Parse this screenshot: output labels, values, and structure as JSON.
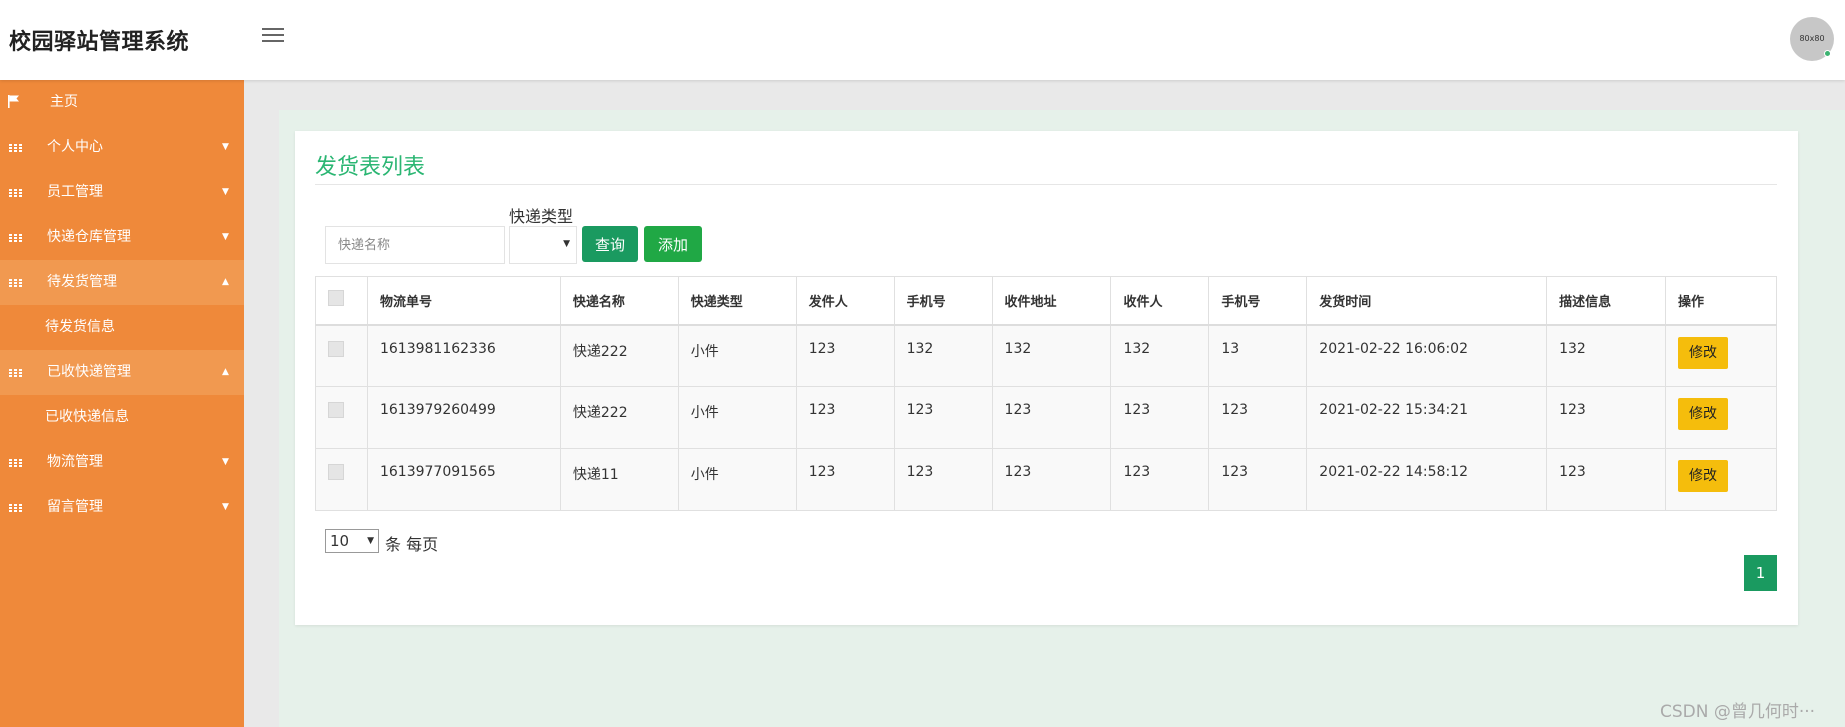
{
  "header": {
    "title": "校园驿站管理系统",
    "avatar_text": "80x80"
  },
  "sidebar": {
    "items": [
      {
        "label": "主页",
        "icon": "flag-icon"
      },
      {
        "label": "个人中心",
        "icon": "grid-icon"
      },
      {
        "label": "员工管理",
        "icon": "grid-icon"
      },
      {
        "label": "快递仓库管理",
        "icon": "grid-icon"
      },
      {
        "label": "待发货管理",
        "icon": "grid-icon"
      },
      {
        "label": "待发货信息"
      },
      {
        "label": "已收快递管理",
        "icon": "grid-icon"
      },
      {
        "label": "已收快递信息"
      },
      {
        "label": "物流管理",
        "icon": "grid-icon"
      },
      {
        "label": "留言管理",
        "icon": "grid-icon"
      }
    ]
  },
  "card": {
    "title": "发货表列表",
    "search": {
      "placeholder": "快递名称",
      "type_label": "快递类型",
      "type_value": "",
      "query_label": "查询",
      "add_label": "添加"
    },
    "table": {
      "headers": [
        "物流单号",
        "快递名称",
        "快递类型",
        "发件人",
        "手机号",
        "收件地址",
        "收件人",
        "手机号",
        "发货时间",
        "描述信息",
        "操作"
      ],
      "edit_label": "修改",
      "rows": [
        [
          "1613981162336",
          "快递222",
          "小件",
          "123",
          "132",
          "132",
          "132",
          "13",
          "2021-02-22 16:06:02",
          "132"
        ],
        [
          "1613979260499",
          "快递222",
          "小件",
          "123",
          "123",
          "123",
          "123",
          "123",
          "2021-02-22 15:34:21",
          "123"
        ],
        [
          "1613977091565",
          "快递11",
          "小件",
          "123",
          "123",
          "123",
          "123",
          "123",
          "2021-02-22 14:58:12",
          "123"
        ]
      ]
    },
    "pagination": {
      "page_size": "10",
      "page_size_suffix": "条 每页",
      "current_page": "1"
    }
  },
  "watermark": "CSDN @曾几何时···",
  "colors": {
    "sidebar": "#ef893a",
    "accent_green": "#1a9a60",
    "title_green": "#2bb673",
    "edit_button": "#f5bd0c"
  }
}
